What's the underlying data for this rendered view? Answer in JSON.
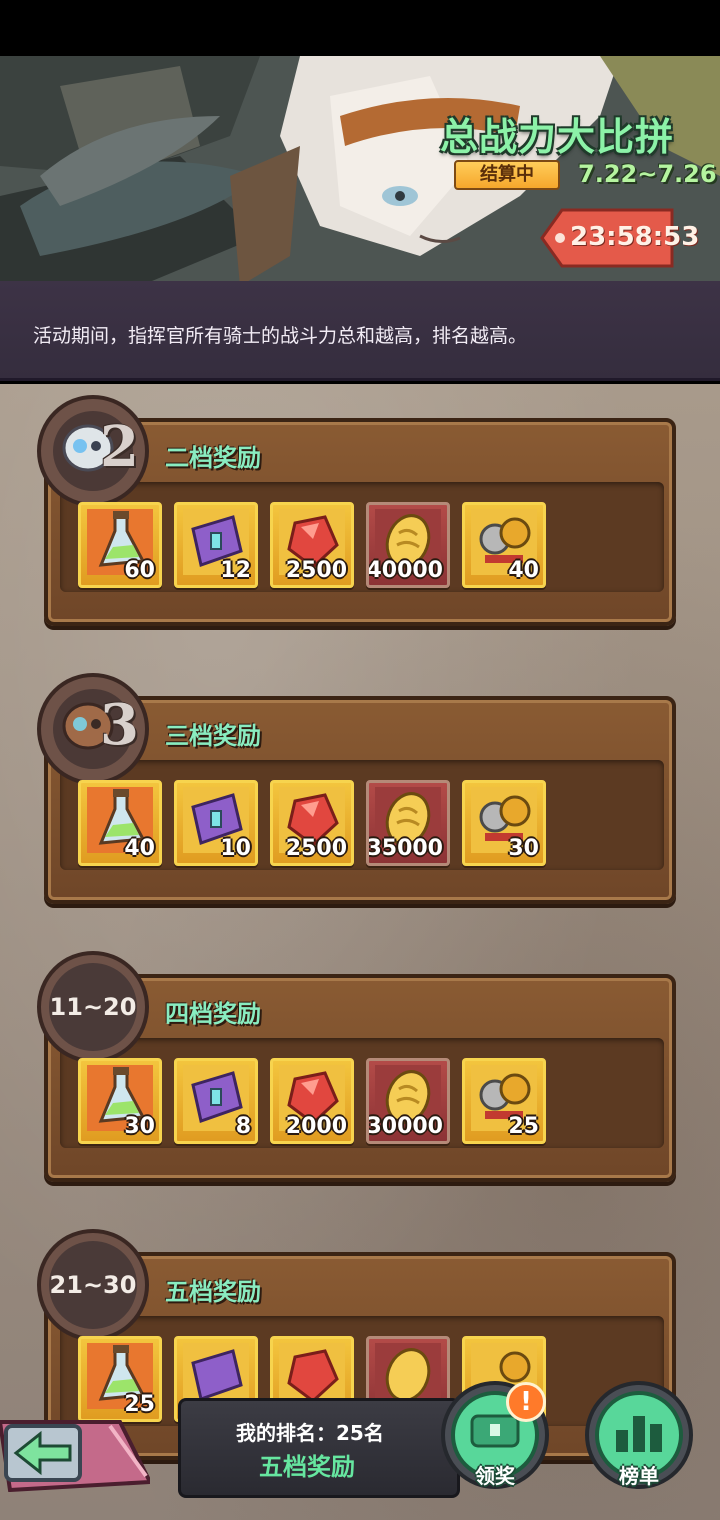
{
  "banner": {
    "title": "总战力大比拼",
    "status": "结算中",
    "date_range": "7.22~7.26",
    "countdown": "23:58:53"
  },
  "description": "活动期间，指挥官所有骑士的战斗力总和越高，排名越高。",
  "tiers": [
    {
      "rank": "2",
      "title": "二档奖励",
      "items": [
        {
          "icon": "potion-icon",
          "count": "60"
        },
        {
          "icon": "skill-book-icon",
          "count": "12"
        },
        {
          "icon": "ruby-gem-icon",
          "count": "2500"
        },
        {
          "icon": "gold-coin-icon",
          "count": "40000"
        },
        {
          "icon": "gear-parts-icon",
          "count": "40"
        }
      ]
    },
    {
      "rank": "3",
      "title": "三档奖励",
      "items": [
        {
          "icon": "potion-icon",
          "count": "40"
        },
        {
          "icon": "skill-book-icon",
          "count": "10"
        },
        {
          "icon": "ruby-gem-icon",
          "count": "2500"
        },
        {
          "icon": "gold-coin-icon",
          "count": "35000"
        },
        {
          "icon": "gear-parts-icon",
          "count": "30"
        }
      ]
    },
    {
      "rank": "11~20",
      "title": "四档奖励",
      "items": [
        {
          "icon": "potion-icon",
          "count": "30"
        },
        {
          "icon": "skill-book-icon",
          "count": "8"
        },
        {
          "icon": "ruby-gem-icon",
          "count": "2000"
        },
        {
          "icon": "gold-coin-icon",
          "count": "30000"
        },
        {
          "icon": "gear-parts-icon",
          "count": "25"
        }
      ]
    },
    {
      "rank": "21~30",
      "title": "五档奖励",
      "items": [
        {
          "icon": "potion-icon",
          "count": "25"
        }
      ]
    }
  ],
  "bottom": {
    "my_rank_label": "我的排名：25名",
    "my_rank_tier": "五档奖励",
    "claim_label": "领奖",
    "claim_alert": "!",
    "leaderboard_label": "榜单"
  },
  "colors": {
    "accent_green": "#89ecc0",
    "panel_brown": "#6f4628",
    "item_gold": "#f3c53e",
    "item_red": "#8c3335",
    "timer_red": "#e45a4a"
  }
}
